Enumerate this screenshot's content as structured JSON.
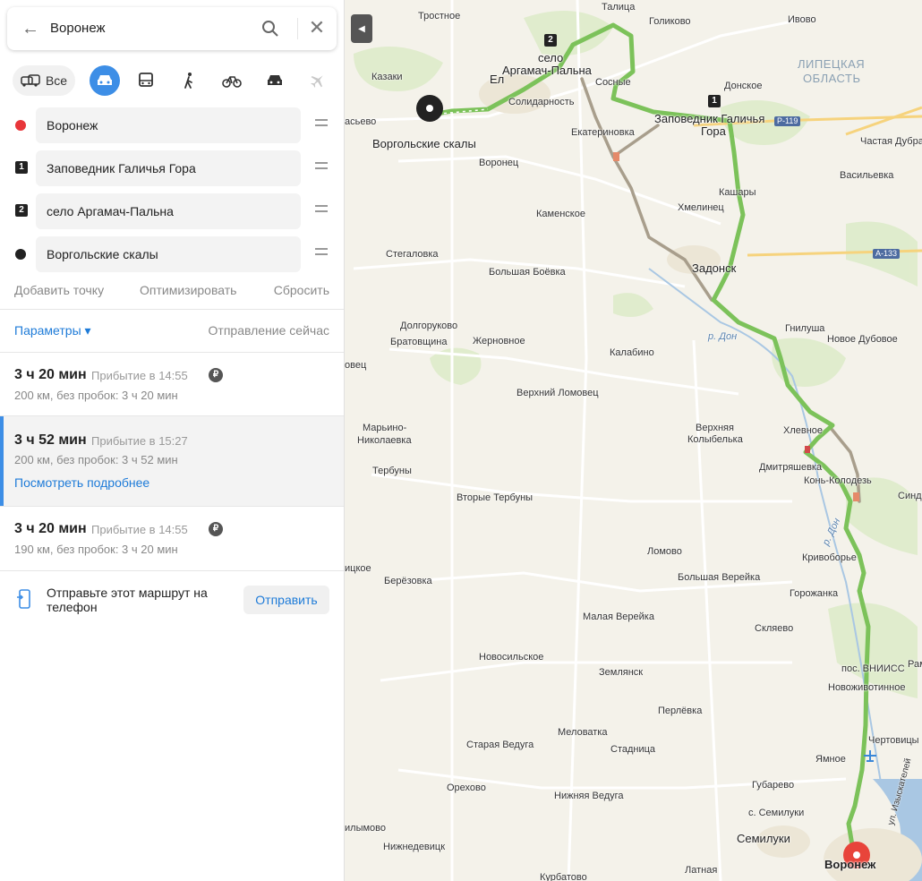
{
  "search": {
    "value": "Воронеж"
  },
  "modes": {
    "all_label": "Все"
  },
  "waypoints": [
    {
      "label": "Воронеж",
      "marker": "red-dot"
    },
    {
      "label": "Заповедник Галичья Гора",
      "marker": "1"
    },
    {
      "label": "село Аргамач-Пальна",
      "marker": "2"
    },
    {
      "label": "Воргольские скалы",
      "marker": "black-dot"
    }
  ],
  "actions": {
    "add": "Добавить точку",
    "optimize": "Оптимизировать",
    "reset": "Сбросить"
  },
  "params": {
    "label": "Параметры ▾",
    "departure": "Отправление сейчас"
  },
  "routes": [
    {
      "duration": "3 ч 20 мин",
      "arrival": "Прибытие в 14:55",
      "details": "200 км, без пробок: 3 ч 20 мин",
      "toll": "₽"
    },
    {
      "duration": "3 ч 52 мин",
      "arrival": "Прибытие в 15:27",
      "details": "200 км, без пробок: 3 ч 52 мин",
      "more": "Посмотреть подробнее"
    },
    {
      "duration": "3 ч 20 мин",
      "arrival": "Прибытие в 14:55",
      "details": "190 км, без пробок: 3 ч 20 мин",
      "toll": "₽"
    }
  ],
  "send": {
    "text": "Отправьте этот маршрут на телефон",
    "button": "Отправить"
  },
  "map": {
    "route_color": "#7cc25a",
    "alt_route_color": "#a89e8c",
    "labels": {
      "trostnoe": "Тростное",
      "talitsa": "Талица",
      "golikovo": "Голиково",
      "ivovo": "Ивово",
      "selo": "село",
      "argamach": "Аргамач-Пальна",
      "kazaki": "Казаки",
      "elets": "Ел",
      "lipetsk_region_1": "ЛИПЕЦКАЯ",
      "lipetsk_region_2": "ОБЛАСТЬ",
      "donskoe": "Донское",
      "solidarnost": "Солидарность",
      "sosnie": "Сосные",
      "zapovednik": "Заповедник Галичья",
      "gora": "Гора",
      "vorgol": "Воргольские скалы",
      "kasyevo": "асьево",
      "ekaterinovka": "Екатериновка",
      "chastaya_dubrava": "Частая Дубра",
      "voronets": "Воронец",
      "vasilevka": "Васильевка",
      "kashary": "Кашары",
      "khmelinets": "Хмелинец",
      "kamenskoe": "Каменское",
      "stegalovka": "Стегаловка",
      "bolshaya_boevka": "Большая Боёвка",
      "zadonsk": "Задонск",
      "dolgorukovo": "Долгоруково",
      "bratovshchina": "Братовщина",
      "zhernovnoe": "Жерновное",
      "gnilusha": "Гнилуша",
      "novoe_dubovoe": "Новое Дубовое",
      "r_don": "р. Дон",
      "kalabino": "Калабино",
      "ovets": "овец",
      "verkhniy_lomovets": "Верхний Ломовец",
      "verkhnyaya_1": "Верхняя",
      "kolybelka": "Колыбелька",
      "marino": "Марьино-",
      "nikolaevka": "Николаевка",
      "khlevnoe": "Хлевное",
      "dmitryashevka": "Дмитряшевка",
      "kon_kolodez": "Конь-Колодезь",
      "terbuny": "Тербуны",
      "vtorye_terbuny": "Вторые Тербуны",
      "sind": "Синд",
      "r_don2": "р. Дон",
      "lomovo": "Ломово",
      "krivobore": "Кривоборье",
      "itskoe": "ицкое",
      "berezovka": "Берёзовка",
      "bolshaya_vereyka": "Большая Верейка",
      "gorozhanka": "Горожанка",
      "malaya_vereyka": "Малая Верейка",
      "sklyaevo": "Скляево",
      "novosilskoe": "Новосильское",
      "zemlyansk": "Землянск",
      "pos_vniiss": "пос. ВНИИСС",
      "ram": "Рам",
      "novozhivotinnoe": "Новоживотинное",
      "perlevka": "Перлёвка",
      "melovatka": "Меловатка",
      "staraya_vedu": "Старая Ведуга",
      "stadnitsa": "Стадница",
      "chertovitsy": "Чертовицы",
      "yamnoe": "Ямное",
      "orekhovo": "Орехово",
      "gubarevo": "Губарево",
      "nizhnyaya_vedu": "Нижняя Ведуга",
      "s_semiluki": "с. Семилуки",
      "ul_izyskateley": "ул. Изыскателей",
      "ilymovo": "илымово",
      "nizhnedevitsk": "Нижнедевицк",
      "semiluki": "Семилуки",
      "latnaya": "Латная",
      "voronezh": "Воронеж",
      "kurbatovo": "Курбатово"
    },
    "highways": {
      "r119": "Р-119",
      "a133": "А-133"
    },
    "badges": {
      "w1": "1",
      "w2": "2"
    }
  }
}
